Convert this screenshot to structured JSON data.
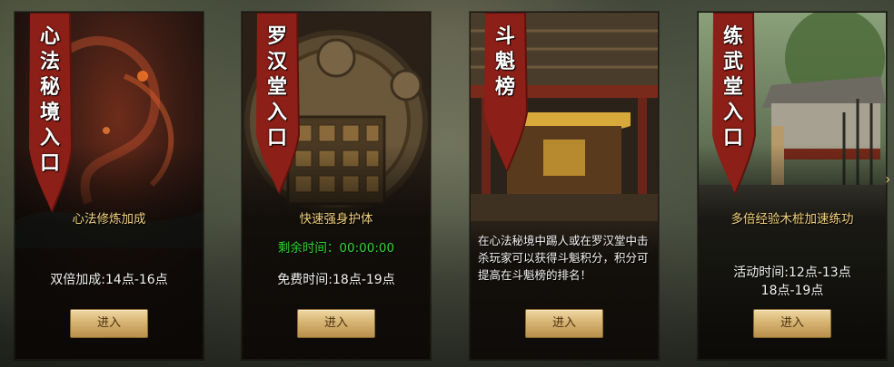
{
  "cards": [
    {
      "title_chars": [
        "心",
        "法",
        "秘",
        "境",
        "入",
        "口"
      ],
      "subtitle": "心法修炼加成",
      "info": "双倍加成:14点-16点",
      "button": "进入"
    },
    {
      "title_chars": [
        "罗",
        "汉",
        "堂",
        "入",
        "口"
      ],
      "subtitle": "快速强身护体",
      "countdown": "剩余时间：00:00:00",
      "info": "免费时间:18点-19点",
      "button": "进入"
    },
    {
      "title_chars": [
        "斗",
        "魁",
        "榜"
      ],
      "desc": "在心法秘境中踢人或在罗汉堂中击杀玩家可以获得斗魁积分，积分可提高在斗魁榜的排名！",
      "button": "进入"
    },
    {
      "title_chars": [
        "练",
        "武",
        "堂",
        "入",
        "口"
      ],
      "subtitle": "多倍经验木桩加速练功",
      "info_line1": "活动时间:12点-13点",
      "info_line2": "18点-19点",
      "button": "进入"
    }
  ],
  "next_arrow": "›",
  "colors": {
    "banner_red": "#8c1f17",
    "subtitle_gold": "#f1d07a",
    "countdown_green": "#2fd62f",
    "button_gold": "#d7b472"
  }
}
